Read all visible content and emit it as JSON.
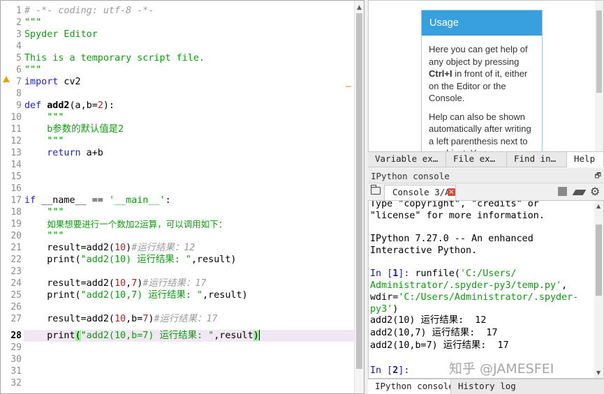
{
  "editor": {
    "line_numbers": [
      "1",
      "2",
      "3",
      "4",
      "5",
      "6",
      "7",
      "8",
      "9",
      "10",
      "11",
      "12",
      "13",
      "14",
      "15",
      "16",
      "17",
      "18",
      "19",
      "20",
      "21",
      "22",
      "23",
      "24",
      "25",
      "26",
      "27",
      "28",
      "29",
      "30",
      "31",
      "32"
    ],
    "current_line": "28",
    "lines": {
      "l1": "# -*- coding: utf-8 -*-",
      "l2": "\"\"\"",
      "l3": "Spyder Editor",
      "l5": "This is a temporary script file.",
      "l6": "\"\"\"",
      "l7_kw": "import",
      "l7_rest": " cv2",
      "l9_kw": "def",
      "l9_fn": "add2",
      "l9_a": "(a,b=",
      "l9_num": "2",
      "l9_b": "):",
      "l10": "\"\"\"",
      "l11": "b参数的默认值是2",
      "l12": "\"\"\"",
      "l13_kw": "return",
      "l13_rest": " a+b",
      "l17_kw": "if",
      "l17_a": " __name__ == ",
      "l17_str": "'__main__'",
      "l17_b": ":",
      "l18": "\"\"\"",
      "l19": "如果想要进行一个数加2运算，可以调用如下：",
      "l20": "\"\"\"",
      "l21_a": "result=add2(",
      "l21_num": "10",
      "l21_b": ")",
      "l21_cm": "#运行结果：12",
      "l22_a": "print(",
      "l22_str": "\"add2(10) 运行结果: \"",
      "l22_b": ",result)",
      "l24_a": "result=add2(",
      "l24_num1": "10",
      "l24_c": ",",
      "l24_num2": "7",
      "l24_b": ")",
      "l24_cm": "#运行结果：17",
      "l25_a": "print(",
      "l25_str": "\"add2(10,7) 运行结果: \"",
      "l25_b": ",result)",
      "l27_a": "result=add2(",
      "l27_num1": "10",
      "l27_c": ",b=",
      "l27_num2": "7",
      "l27_b": ")",
      "l27_cm": "#运行结果：17",
      "l28_a": "print",
      "l28_p1": "(",
      "l28_str": "\"add2(10,b=7) 运行结果: \"",
      "l28_b": ",result",
      "l28_p2": ")"
    }
  },
  "help": {
    "title": "Usage",
    "para1_a": "Here you can get help of any object by pressing ",
    "para1_key": "Ctrl+I",
    "para1_b": " in front of it, either on the Editor or the Console.",
    "para2": "Help can also be shown automatically after writing a left parenthesis next to an object. You"
  },
  "top_tabs": [
    "Variable ex…",
    "File ex…",
    "Find in…",
    "Help"
  ],
  "ipython": {
    "title": "IPython console",
    "tab_label": "Console 3/A",
    "lines": {
      "c1": "Type \"copyright\", \"credits\" or",
      "c2": "\"license\" for more information.",
      "c4": "IPython 7.27.0 -- An enhanced",
      "c5": "Interactive Python.",
      "c7_prompt": "In [",
      "c7_num": "1",
      "c7_end": "]: ",
      "c7_cmd": "runfile(",
      "c7_str": "'C:/Users/",
      "c8": "Administrator/.spyder-py3/temp.py'",
      "c8_end": ",",
      "c9_a": "wdir=",
      "c9_str": "'C:/Users/Administrator/.spyder-",
      "c10_str": "py3'",
      "c10_end": ")",
      "c11": "add2(10) 运行结果:  12",
      "c12": "add2(10,7) 运行结果:  17",
      "c13": "add2(10,b=7) 运行结果:  17",
      "c15_prompt": "In [",
      "c15_num": "2",
      "c15_end": "]:"
    },
    "watermark": "知乎 @JAMESFEI"
  },
  "bottom_tabs": [
    "IPython console",
    "History log"
  ],
  "colors": {
    "comment": "#9a9a9a",
    "string": "#0b9e0b",
    "keyword": "#1c1cd6",
    "number": "#a0292a",
    "current_line_bg": "#f1e8f4",
    "help_header": "#39a0df"
  }
}
